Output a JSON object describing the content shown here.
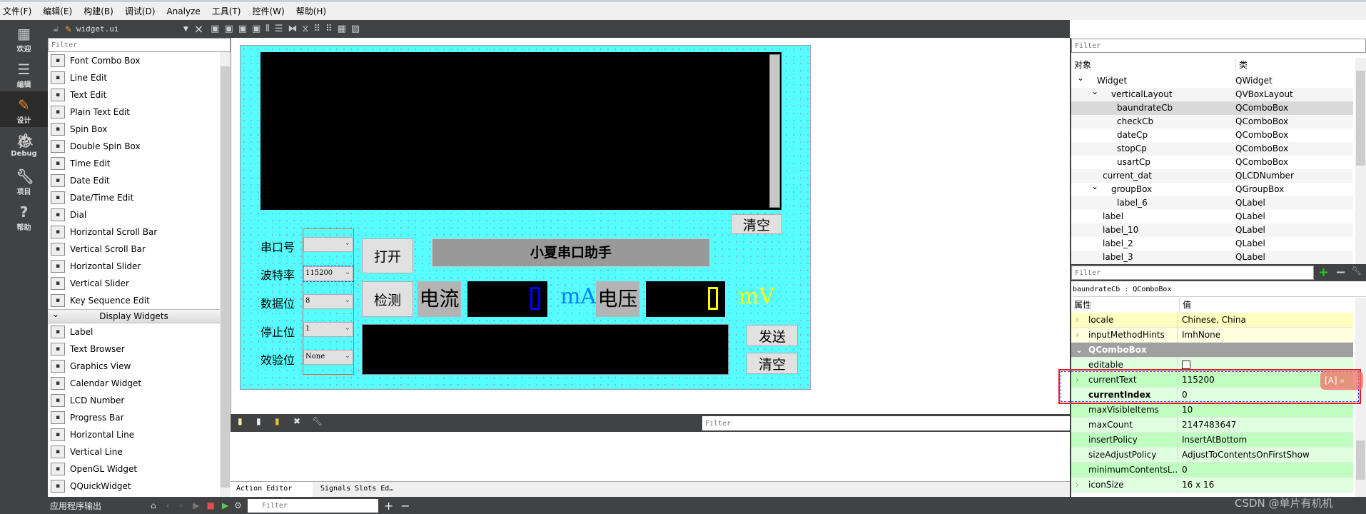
{
  "menu": [
    "文件(F)",
    "编辑(E)",
    "构建(B)",
    "调试(D)",
    "Analyze",
    "工具(T)",
    "控件(W)",
    "帮助(H)"
  ],
  "toolbar": {
    "file": "widget.ui",
    "close": "×"
  },
  "modes": [
    {
      "label": "欢迎",
      "icon": "grid-icon"
    },
    {
      "label": "编辑",
      "icon": "edit-doc-icon"
    },
    {
      "label": "设计",
      "icon": "pencil-icon"
    },
    {
      "label": "Debug",
      "icon": "bug-icon"
    },
    {
      "label": "项目",
      "icon": "wrench-icon"
    },
    {
      "label": "帮助",
      "icon": "help-icon"
    }
  ],
  "widgetbox": {
    "filter": "Filter",
    "items1": [
      "Font Combo Box",
      "Line Edit",
      "Text Edit",
      "Plain Text Edit",
      "Spin Box",
      "Double Spin Box",
      "Time Edit",
      "Date Edit",
      "Date/Time Edit",
      "Dial",
      "Horizontal Scroll Bar",
      "Vertical Scroll Bar",
      "Horizontal Slider",
      "Vertical Slider",
      "Key Sequence Edit"
    ],
    "section": "Display Widgets",
    "items2": [
      "Label",
      "Text Browser",
      "Graphics View",
      "Calendar Widget",
      "LCD Number",
      "Progress Bar",
      "Horizontal Line",
      "Vertical Line",
      "OpenGL Widget",
      "QQuickWidget"
    ]
  },
  "form": {
    "clear_top": "清空",
    "labels": [
      "串口号",
      "波特率",
      "数据位",
      "停止位",
      "效验位"
    ],
    "combos": [
      "",
      "115200",
      "8",
      "1",
      "None"
    ],
    "open": "打开",
    "title": "小夏串口助手",
    "detect": "检测",
    "current_label": "电流",
    "current_value": "0",
    "current_unit": "mA",
    "voltage_label": "电压",
    "voltage_value": "0",
    "voltage_unit": "mV",
    "send": "发送",
    "clear_bottom": "清空",
    "colors": {
      "background": "#55ffff",
      "current_digit": "#0000ff",
      "voltage_digit": "#ffff00",
      "ma": "#0080ff",
      "mv": "#ffff00"
    }
  },
  "action_editor": {
    "filter": "Filter",
    "tabs": [
      "Action Editor",
      "Signals  Slots Ed…"
    ]
  },
  "bottom": {
    "label": "应用程序输出",
    "filter": "Filter"
  },
  "object_inspector": {
    "filter": "Filter",
    "headers": [
      "对象",
      "类"
    ],
    "rows": [
      {
        "name": "Widget",
        "cls": "QWidget",
        "level": 0,
        "expand": "⌄"
      },
      {
        "name": "verticalLayout",
        "cls": "QVBoxLayout",
        "level": 1,
        "expand": "⌄"
      },
      {
        "name": "baundrateCb",
        "cls": "QComboBox",
        "level": 2,
        "selected": true
      },
      {
        "name": "checkCb",
        "cls": "QComboBox",
        "level": 2
      },
      {
        "name": "dateCp",
        "cls": "QComboBox",
        "level": 2
      },
      {
        "name": "stopCp",
        "cls": "QComboBox",
        "level": 2
      },
      {
        "name": "usartCp",
        "cls": "QComboBox",
        "level": 2
      },
      {
        "name": "current_dat",
        "cls": "QLCDNumber",
        "level": 1
      },
      {
        "name": "groupBox",
        "cls": "QGroupBox",
        "level": 1,
        "expand": "⌄"
      },
      {
        "name": "label_6",
        "cls": "QLabel",
        "level": 2
      },
      {
        "name": "label",
        "cls": "QLabel",
        "level": 1
      },
      {
        "name": "label_10",
        "cls": "QLabel",
        "level": 1
      },
      {
        "name": "label_2",
        "cls": "QLabel",
        "level": 1
      },
      {
        "name": "label_3",
        "cls": "QLabel",
        "level": 1
      }
    ]
  },
  "property_editor": {
    "filter": "Filter",
    "context": "baundrateCb : QComboBox",
    "headers": [
      "属性",
      "值"
    ],
    "rows": [
      {
        "name": "locale",
        "value": "Chinese, China",
        "kind": "y",
        "exp": true
      },
      {
        "name": "inputMethodHints",
        "value": "ImhNone",
        "kind": "y",
        "exp": true
      },
      {
        "name": "QComboBox",
        "value": "",
        "kind": "h"
      },
      {
        "name": "editable",
        "value": "",
        "kind": "g",
        "checkbox": true
      },
      {
        "name": "currentText",
        "value": "115200",
        "kind": "g",
        "exp": true
      },
      {
        "name": "currentIndex",
        "value": "0",
        "kind": "g",
        "bold": true
      },
      {
        "name": "maxVisibleItems",
        "value": "10",
        "kind": "g"
      },
      {
        "name": "maxCount",
        "value": "2147483647",
        "kind": "g"
      },
      {
        "name": "insertPolicy",
        "value": "InsertAtBottom",
        "kind": "g"
      },
      {
        "name": "sizeAdjustPolicy",
        "value": "AdjustToContentsOnFirstShow",
        "kind": "g"
      },
      {
        "name": "minimumContentsL...",
        "value": "0",
        "kind": "g"
      },
      {
        "name": "iconSize",
        "value": "16 x 16",
        "kind": "g",
        "exp": true
      }
    ]
  },
  "watermark": "CSDN @单片有机机"
}
